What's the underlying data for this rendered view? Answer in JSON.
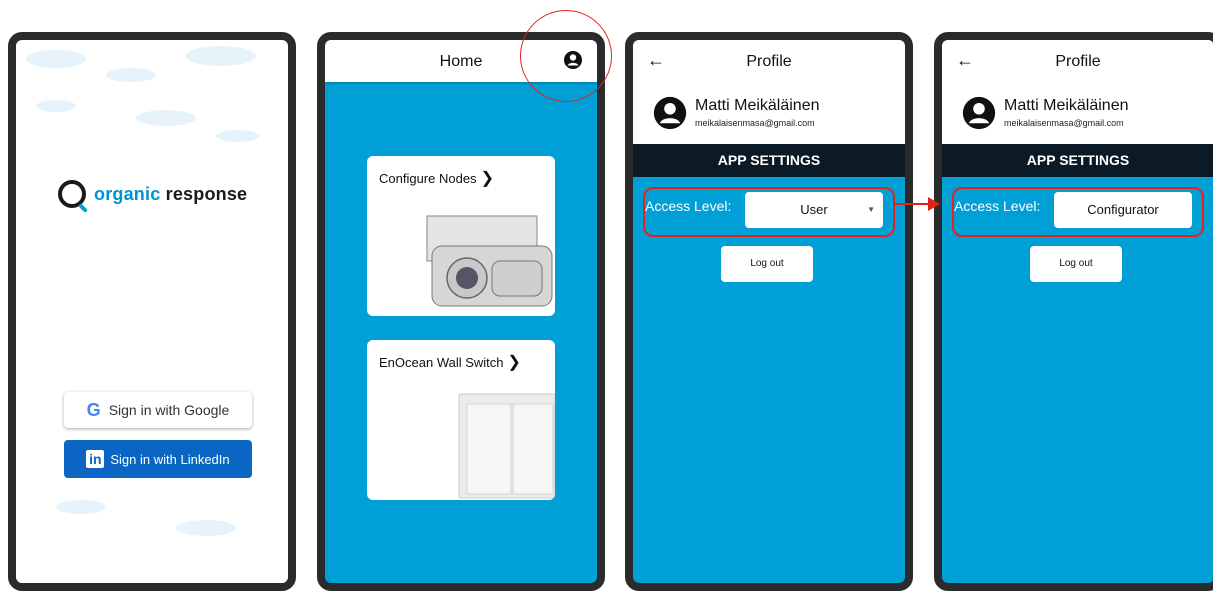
{
  "login": {
    "logo_part1": "organic",
    "logo_part2": "response",
    "google_label": "Sign in with Google",
    "linkedin_label": "Sign in with LinkedIn"
  },
  "home": {
    "title": "Home",
    "cards": [
      {
        "label": "Configure Nodes"
      },
      {
        "label": "EnOcean Wall Switch"
      }
    ]
  },
  "profile_user": {
    "title": "Profile",
    "name": "Matti Meikäläinen",
    "email": "meikalaisenmasa@gmail.com",
    "settings_header": "APP SETTINGS",
    "access_label": "Access Level:",
    "access_value": "User",
    "logout_label": "Log out"
  },
  "profile_config": {
    "title": "Profile",
    "name": "Matti Meikäläinen",
    "email": "meikalaisenmasa@gmail.com",
    "settings_header": "APP SETTINGS",
    "access_label": "Access Level:",
    "access_value": "Configurator",
    "logout_label": "Log out"
  },
  "icons": {
    "back": "arrow-left-icon",
    "profile": "user-circle-icon",
    "chevron": "chevron-right-icon",
    "google": "google-icon",
    "linkedin": "linkedin-icon"
  },
  "colors": {
    "brand_blue": "#00a0d6",
    "linkedin_blue": "#0a66c2",
    "settings_bar": "#0b1a24",
    "highlight_red": "#e2231a"
  }
}
